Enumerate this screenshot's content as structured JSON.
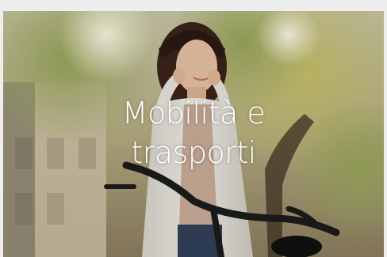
{
  "card": {
    "title_line1": "Mobilità e",
    "title_line2": "trasporti"
  }
}
